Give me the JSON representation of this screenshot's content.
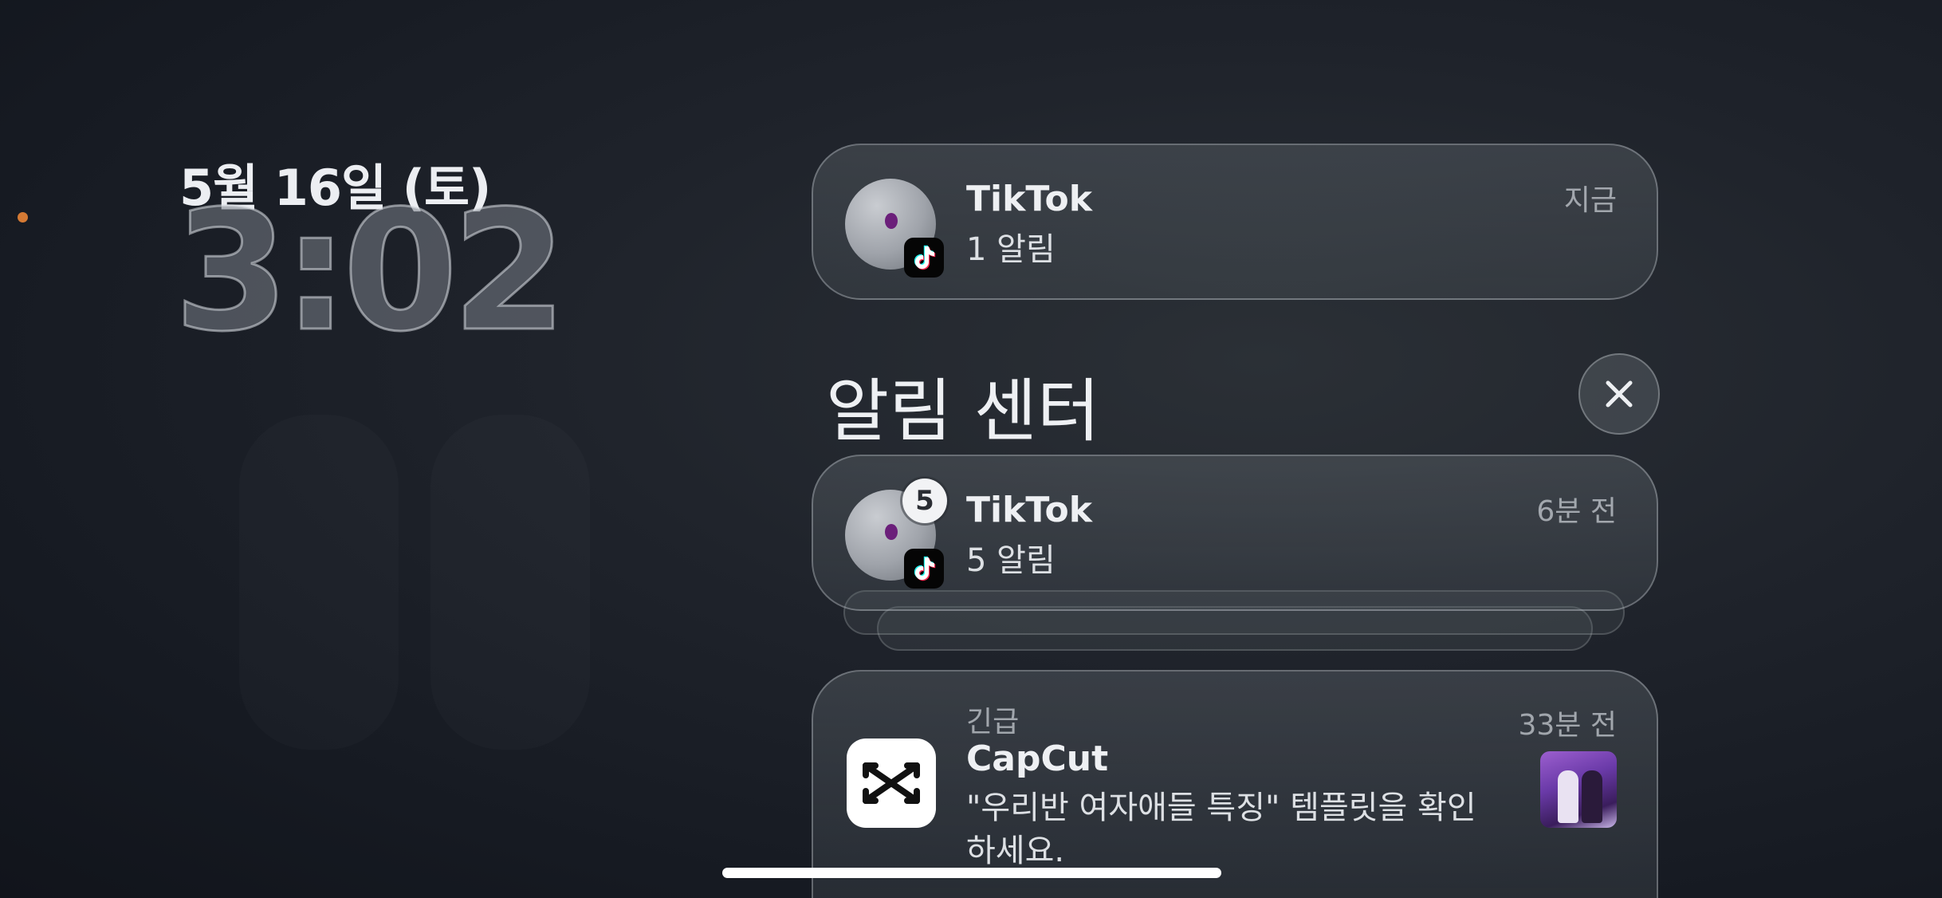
{
  "lock_screen": {
    "date": "5월 16일 (토)",
    "time": "3:02"
  },
  "pinned_notification": {
    "app": "TikTok",
    "body": "1 알림",
    "time": "지금",
    "icon": "tiktok-icon"
  },
  "notification_center": {
    "title": "알림 센터",
    "close_icon": "close-icon"
  },
  "notifications": [
    {
      "app": "TikTok",
      "body": "5 알림",
      "time": "6분 전",
      "badge_count": "5",
      "icon": "tiktok-icon",
      "stacked": true
    },
    {
      "label": "긴급",
      "app": "CapCut",
      "body_line1": "\"우리반 여자애들 특징\" 템플릿을 확인",
      "body_line2": "하세요.",
      "time": "33분 전",
      "icon": "capcut-icon"
    }
  ],
  "colors": {
    "privacy_indicator": "#d57a34",
    "background": "#1f232b"
  }
}
